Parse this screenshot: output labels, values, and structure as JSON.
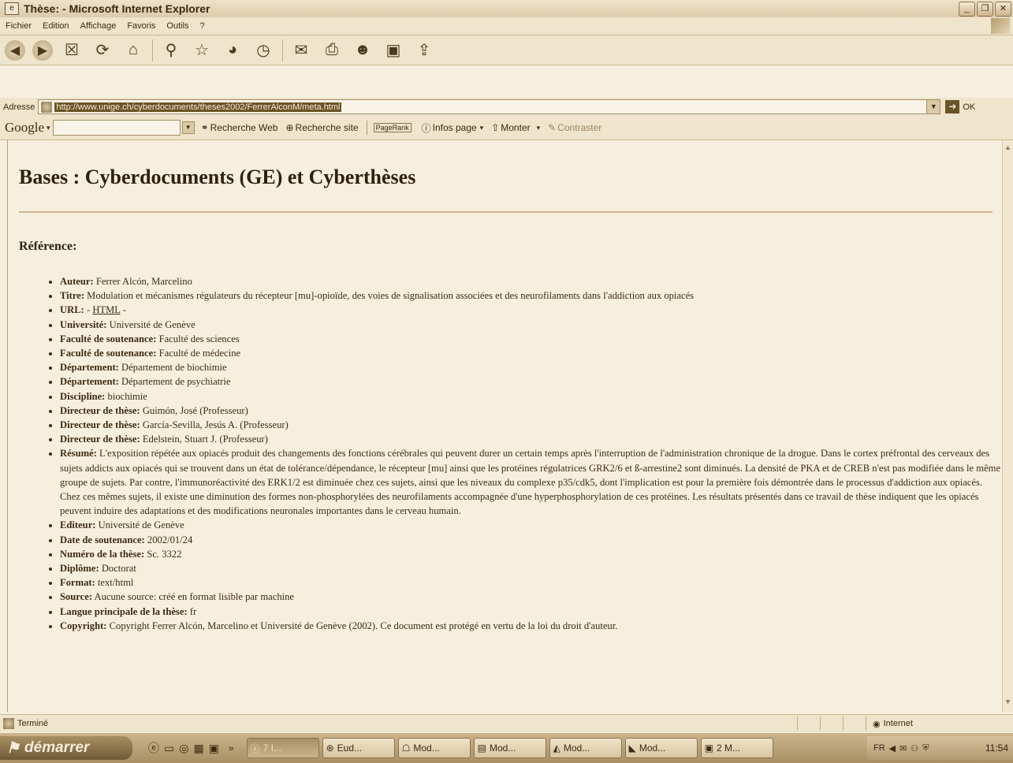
{
  "window": {
    "title": "Thèse: - Microsoft Internet Explorer"
  },
  "menu": [
    "Fichier",
    "Edition",
    "Affichage",
    "Favoris",
    "Outils",
    "?"
  ],
  "address": {
    "label": "Adresse",
    "url": "http://www.unige.ch/cyberdocuments/theses2002/FerrerAlconM/meta.html",
    "go_label": "OK"
  },
  "googlebar": {
    "logo": "Google",
    "web_search": "Recherche Web",
    "site_search": "Recherche site",
    "pagerank": "PageRank",
    "page_info": "Infos page",
    "up": "Monter",
    "contrast": "Contraster"
  },
  "page": {
    "heading": "Bases : Cyberdocuments (GE) et Cyberthèses",
    "reference_heading": "Référence:",
    "items": [
      {
        "label": "Auteur:",
        "value": "Ferrer Alcón, Marcelino"
      },
      {
        "label": "Titre:",
        "value": "Modulation et mécanismes régulateurs du récepteur [mu]-opioïde, des voies de signalisation associées et des neurofilaments dans l'addiction aux opiacés"
      },
      {
        "label": "URL:",
        "value": "-",
        "link": "HTML",
        "suffix": "-"
      },
      {
        "label": "Université:",
        "value": "Université de Genève"
      },
      {
        "label": "Faculté de soutenance:",
        "value": "Faculté des sciences"
      },
      {
        "label": "Faculté de soutenance:",
        "value": "Faculté de médecine"
      },
      {
        "label": "Département:",
        "value": "Département de biochimie"
      },
      {
        "label": "Département:",
        "value": "Département de psychiatrie"
      },
      {
        "label": "Discipline:",
        "value": "biochimie"
      },
      {
        "label": "Directeur de thèse:",
        "value": "Guimón, José (Professeur)"
      },
      {
        "label": "Directeur de thèse:",
        "value": "García-Sevilla, Jesús A. (Professeur)"
      },
      {
        "label": "Directeur de thèse:",
        "value": "Edelstein, Stuart J. (Professeur)"
      },
      {
        "label": "Résumé:",
        "value": "L'exposition répétée aux opiacés produit des changements des fonctions cérébrales qui peuvent durer un certain temps après l'interruption de l'administration chronique de la drogue. Dans le cortex préfrontal des cerveaux des sujets addicts aux opiacés qui se trouvent dans un état de tolérance/dépendance, le récepteur [mu] ainsi que les protéines régulatrices GRK2/6 et ß-arrestine2 sont diminués. La densité de PKA et de CREB n'est pas modifiée dans le même groupe de sujets. Par contre, l'immunoréactivité des ERK1/2 est diminuée chez ces sujets, ainsi que les niveaux du complexe p35/cdk5, dont l'implication est pour la première fois démontrée dans le processus d'addiction aux opiacés. Chez ces mêmes sujets, il existe une diminution des formes non-phosphorylées des neurofilaments accompagnée d'une hyperphosphorylation de ces protéines. Les résultats présentés dans ce travail de thèse indiquent que les opiacés peuvent induire des adaptations et des modifications neuronales importantes dans le cerveau humain."
      },
      {
        "label": "Editeur:",
        "value": "Université de Genève"
      },
      {
        "label": "Date de soutenance:",
        "value": "2002/01/24"
      },
      {
        "label": "Numéro de la thèse:",
        "value": "Sc. 3322"
      },
      {
        "label": "Diplôme:",
        "value": "Doctorat"
      },
      {
        "label": "Format:",
        "value": "text/html"
      },
      {
        "label": "Source:",
        "value": "Aucune source: créé en format lisible par machine"
      },
      {
        "label": "Langue principale de la thèse:",
        "value": "fr"
      },
      {
        "label": "Copyright:",
        "value": "Copyright Ferrer Alcón, Marcelino et Université de Genève (2002). Ce document est protégé en vertu de la loi du droit d'auteur."
      }
    ]
  },
  "status": {
    "text": "Terminé",
    "zone": "Internet"
  },
  "taskbar": {
    "start": "démarrer",
    "tasks": [
      "7 I...",
      "Eud...",
      "Mod...",
      "Mod...",
      "Mod...",
      "Mod...",
      "2 M..."
    ],
    "lang": "FR",
    "clock": "11:54"
  }
}
